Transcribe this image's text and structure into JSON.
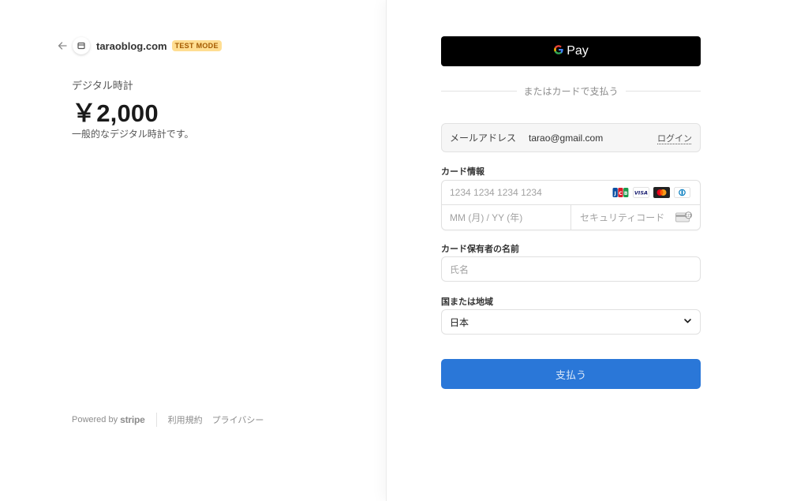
{
  "merchant": {
    "name": "taraoblog.com",
    "badge": "TEST MODE"
  },
  "product": {
    "name": "デジタル時計",
    "price": "￥2,000",
    "description": "一般的なデジタル時計です。"
  },
  "footer": {
    "powered_by": "Powered by",
    "brand": "stripe",
    "links": [
      "利用規約",
      "プライバシー"
    ]
  },
  "payment": {
    "gpay_label": "Pay",
    "or_text": "またはカードで支払う",
    "email": {
      "label": "メールアドレス",
      "value": "tarao@gmail.com",
      "login": "ログイン"
    },
    "card": {
      "label": "カード情報",
      "number_placeholder": "1234 1234 1234 1234",
      "expiry_placeholder": "MM (月) / YY (年)",
      "cvc_placeholder": "セキュリティコード",
      "brands": [
        "jcb-icon",
        "visa-icon",
        "mastercard-icon",
        "diners-icon"
      ]
    },
    "cardholder": {
      "label": "カード保有者の名前",
      "placeholder": "氏名"
    },
    "country": {
      "label": "国または地域",
      "value": "日本"
    },
    "pay_button": "支払う"
  },
  "colors": {
    "pay_button": "#2a77d8",
    "test_badge_bg": "#ffde92",
    "test_badge_text": "#a35a00",
    "gpay_bg": "#000000"
  }
}
